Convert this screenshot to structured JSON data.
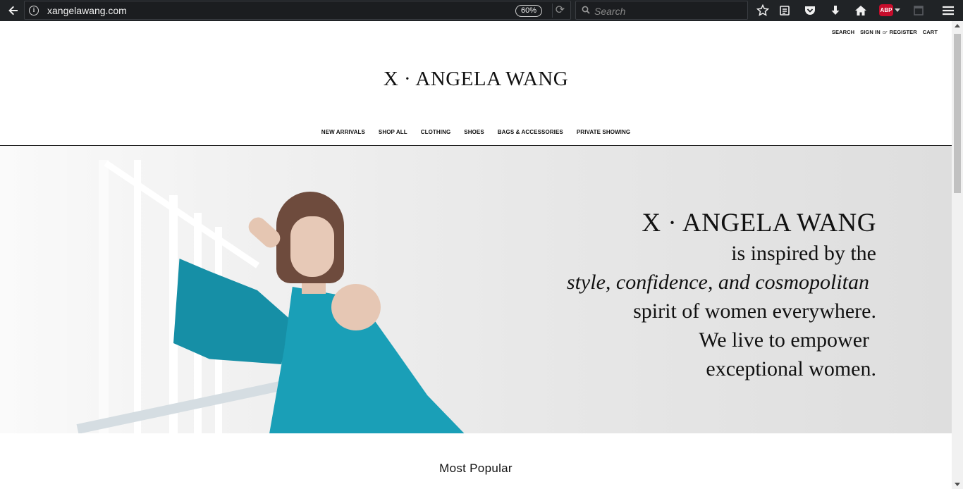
{
  "browser": {
    "url": "xangelawang.com",
    "zoom": "60%",
    "search_placeholder": "Search",
    "icons": [
      "back-arrow-icon",
      "info-icon",
      "reload-icon",
      "search-icon",
      "bookmark-star-icon",
      "reading-list-icon",
      "pocket-icon",
      "download-icon",
      "home-icon",
      "adblock-icon",
      "sidebar-icon",
      "hamburger-menu-icon"
    ],
    "abp_label": "ABP"
  },
  "header": {
    "search_label": "SEARCH",
    "signin_label": "SIGN IN",
    "or_label": "or",
    "register_label": "REGISTER",
    "cart_label": "CART",
    "logo": "X · ANGELA WANG"
  },
  "nav": {
    "items": [
      {
        "label": "NEW ARRIVALS"
      },
      {
        "label": "SHOP ALL"
      },
      {
        "label": "CLOTHING"
      },
      {
        "label": "SHOES"
      },
      {
        "label": "BAGS & ACCESSORIES"
      },
      {
        "label": "PRIVATE SHOWING"
      }
    ]
  },
  "hero": {
    "brand": "X · ANGELA WANG",
    "line1": "is inspired by the",
    "line2": "style, confidence, and cosmopolitan",
    "line3": "spirit of women everywhere.",
    "line4": "We live to empower",
    "line5": "exceptional women.",
    "dress_color": "#1a9fb7"
  },
  "sections": {
    "most_popular": "Most Popular"
  }
}
